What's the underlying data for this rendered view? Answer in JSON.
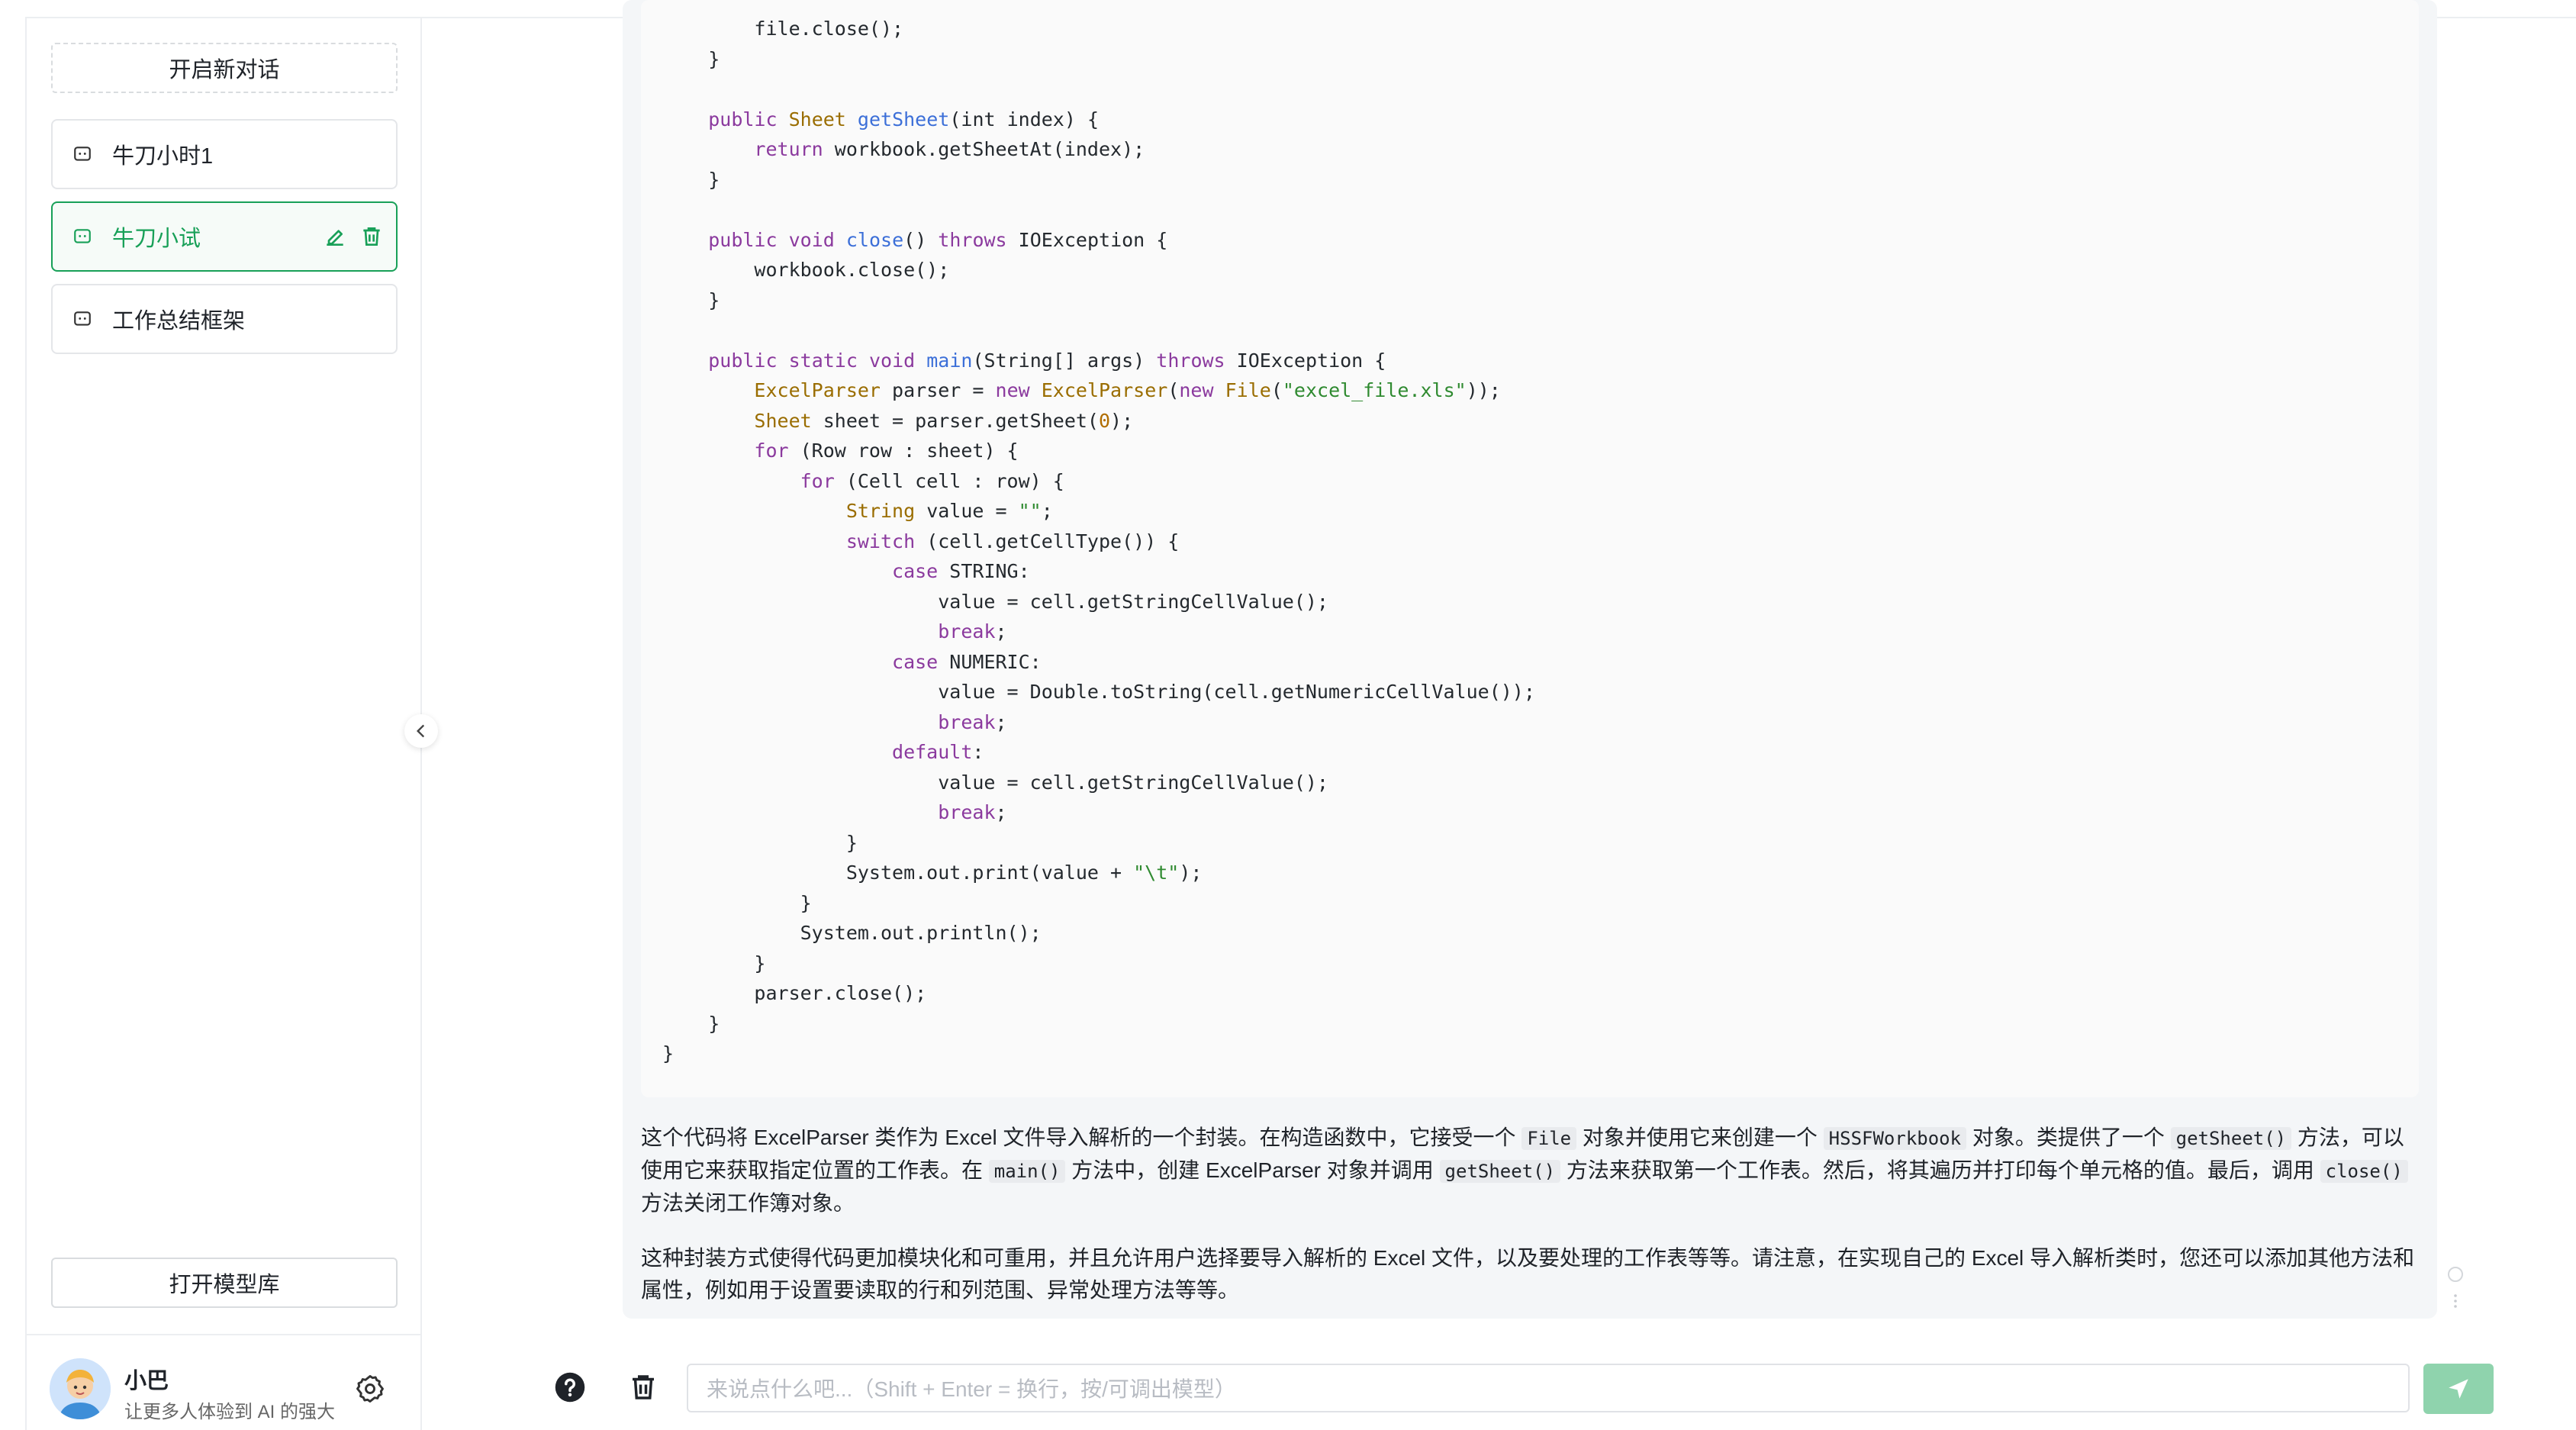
{
  "sidebar": {
    "new_chat_label": "开启新对话",
    "conversations": [
      {
        "title": "牛刀小时1",
        "active": false
      },
      {
        "title": "牛刀小试",
        "active": true
      },
      {
        "title": "工作总结框架",
        "active": false
      }
    ],
    "open_library_label": "打开模型库",
    "user": {
      "name": "小巴",
      "subtitle": "让更多人体验到 AI 的强大"
    }
  },
  "message": {
    "code_lines": [
      "        file.close();",
      "    }",
      "",
      "    public Sheet getSheet(int index) {",
      "        return workbook.getSheetAt(index);",
      "    }",
      "",
      "    public void close() throws IOException {",
      "        workbook.close();",
      "    }",
      "",
      "    public static void main(String[] args) throws IOException {",
      "        ExcelParser parser = new ExcelParser(new File(\"excel_file.xls\"));",
      "        Sheet sheet = parser.getSheet(0);",
      "        for (Row row : sheet) {",
      "            for (Cell cell : row) {",
      "                String value = \"\";",
      "                switch (cell.getCellType()) {",
      "                    case STRING:",
      "                        value = cell.getStringCellValue();",
      "                        break;",
      "                    case NUMERIC:",
      "                        value = Double.toString(cell.getNumericCellValue());",
      "                        break;",
      "                    default:",
      "                        value = cell.getStringCellValue();",
      "                        break;",
      "                }",
      "                System.out.print(value + \"\\t\");",
      "            }",
      "            System.out.println();",
      "        }",
      "        parser.close();",
      "    }",
      "}"
    ],
    "para1": {
      "t1": "这个代码将 ExcelParser 类作为 Excel 文件导入解析的一个封装。在构造函数中，它接受一个 ",
      "c1": "File",
      "t2": " 对象并使用它来创建一个 ",
      "c2": "HSSFWorkbook",
      "t3": " 对象。类提供了一个 ",
      "c3": "getSheet()",
      "t4": " 方法，可以使用它来获取指定位置的工作表。在 ",
      "c4": "main()",
      "t5": " 方法中，创建 ExcelParser 对象并调用 ",
      "c5": "getSheet()",
      "t6": " 方法来获取第一个工作表。然后，将其遍历并打印每个单元格的值。最后，调用 ",
      "c6": "close()",
      "t7": " 方法关闭工作簿对象。"
    },
    "para2": "这种封装方式使得代码更加模块化和可重用，并且允许用户选择要导入解析的 Excel 文件，以及要处理的工作表等等。请注意，在实现自己的 Excel 导入解析类时，您还可以添加其他方法和属性，例如用于设置要读取的行和列范围、异常处理方法等等。"
  },
  "footer": {
    "input_placeholder": "来说点什么吧...（Shift + Enter = 换行，按/可调出模型）"
  },
  "colors": {
    "accent": "#18a058",
    "send_button": "#8fd3ad",
    "bubble_bg": "#f4f6f8"
  }
}
